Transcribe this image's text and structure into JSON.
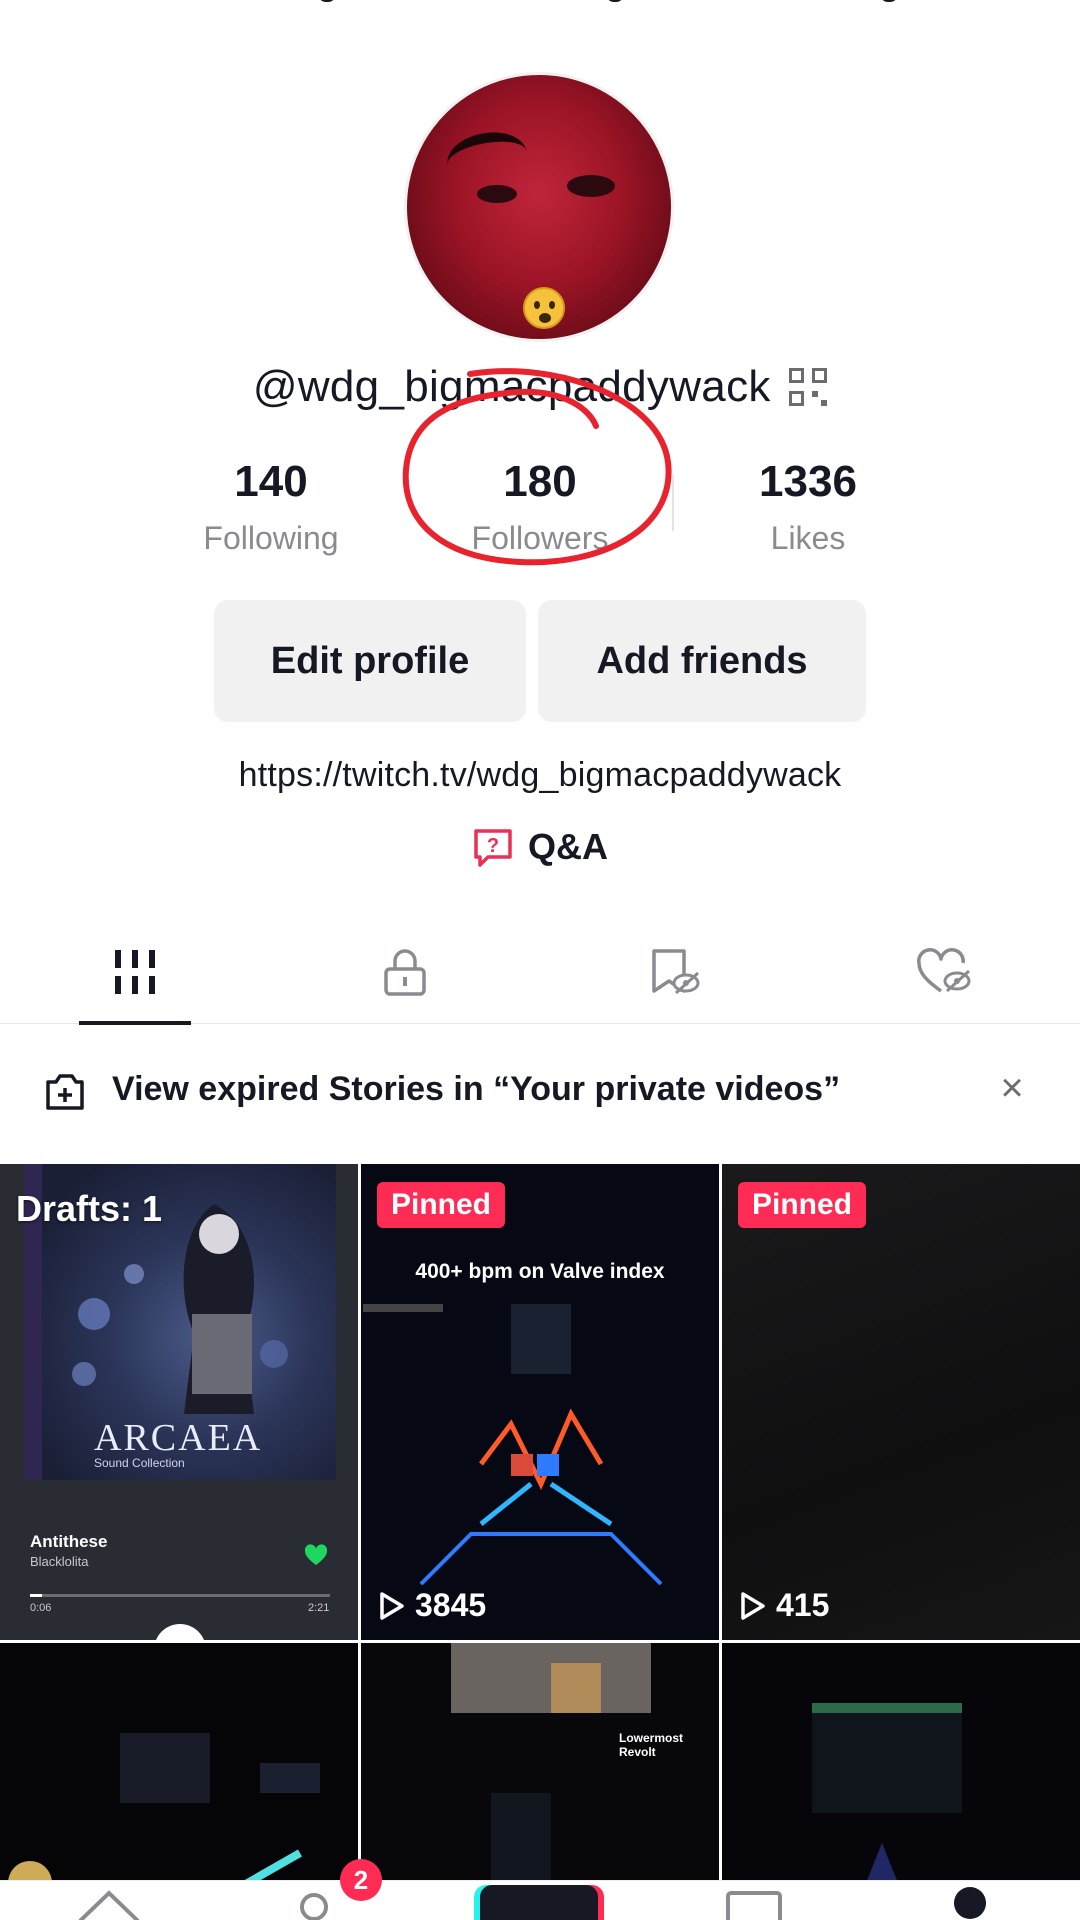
{
  "profile": {
    "handle": "@wdg_bigmacpaddywack",
    "stats": [
      {
        "value": "140",
        "label": "Following"
      },
      {
        "value": "180",
        "label": "Followers"
      },
      {
        "value": "1336",
        "label": "Likes"
      }
    ],
    "edit_button": "Edit profile",
    "add_friends_button": "Add friends",
    "bio_link": "https://twitch.tv/wdg_bigmacpaddywack",
    "qa_label": "Q&A",
    "annotation_color": "#e8232e"
  },
  "tabs": [
    {
      "icon": "videos-grid-icon",
      "active": true
    },
    {
      "icon": "lock-icon",
      "active": false
    },
    {
      "icon": "favorites-hidden-icon",
      "active": false
    },
    {
      "icon": "liked-hidden-icon",
      "active": false
    }
  ],
  "banner": {
    "text": "View expired Stories in “Your private videos”",
    "close": "×"
  },
  "grid": {
    "drafts_label": "Drafts: 1",
    "draft_song": "Antithese",
    "draft_artist": "Blacklolita",
    "draft_album_title": "ARCAEA",
    "draft_album_subtitle": "Sound Collection",
    "draft_time_elapsed": "0:06",
    "draft_time_total": "2:21",
    "draft_progress_fraction": 0.04,
    "pinned_label": "Pinned",
    "video2_caption": "400+ bpm on Valve index",
    "video2_views": "3845",
    "video3_views": "415",
    "video5_caption": "Lowermost Revolt"
  },
  "nav": {
    "inbox_badge": "2"
  },
  "colors": {
    "accent": "#fe2c55",
    "text": "#161823",
    "muted": "#8a8b91",
    "button_bg": "#f1f1f2"
  }
}
